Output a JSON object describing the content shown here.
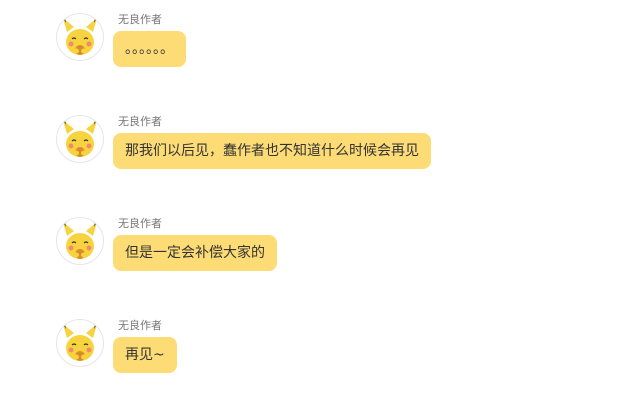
{
  "conversation": {
    "messages": [
      {
        "sender": "无良作者",
        "avatar_icon": "pikachu-avatar-icon",
        "text": "。。。。。。"
      },
      {
        "sender": "无良作者",
        "avatar_icon": "pikachu-avatar-icon",
        "text": "那我们以后见，蠢作者也不知道什么时候会再见"
      },
      {
        "sender": "无良作者",
        "avatar_icon": "pikachu-avatar-icon",
        "text": "但是一定会补偿大家的"
      },
      {
        "sender": "无良作者",
        "avatar_icon": "pikachu-avatar-icon",
        "text": "再见~"
      }
    ]
  },
  "colors": {
    "bubble": "#fddc76",
    "sender_text": "#777777",
    "message_text": "#333333",
    "background": "#ffffff"
  }
}
